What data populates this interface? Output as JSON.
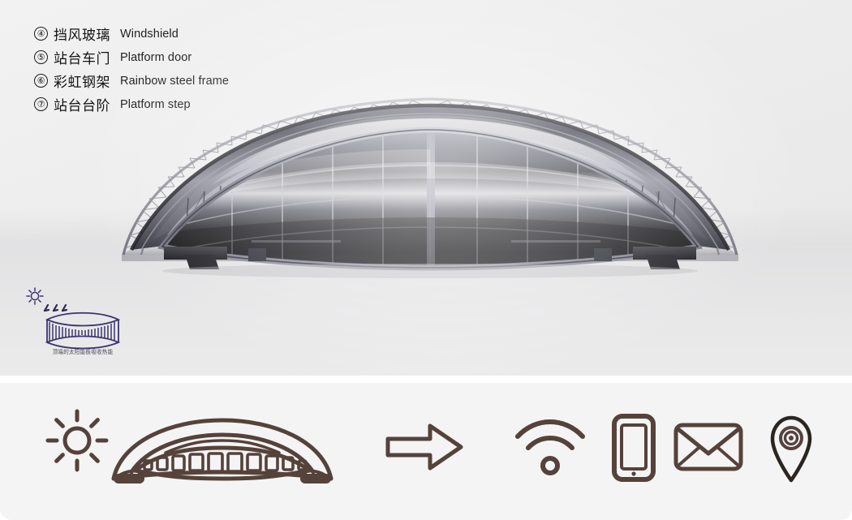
{
  "legend": {
    "items": [
      {
        "number": "④",
        "cn": "挡风玻璃",
        "en": "Windshield"
      },
      {
        "number": "⑤",
        "cn": "站台车门",
        "en": "Platform door"
      },
      {
        "number": "⑥",
        "cn": "彩虹钢架",
        "en": "Rainbow steel frame"
      },
      {
        "number": "⑦",
        "cn": "站台台阶",
        "en": "Platform step"
      }
    ]
  },
  "render": {
    "subject": "lens-shaped arched station building",
    "alt": "3D rendering of a rainbow steel frame transit station with curved glass facade"
  },
  "solar_diagram": {
    "caption": "顶端的太阳能板吸收热能",
    "sun_icon": "sun-icon",
    "heat_arrows": "heat-ray-arrows",
    "structure_icon": "lens-station-section",
    "color": "#3b3470"
  },
  "icon_bar": {
    "accent_color": "#55423a",
    "background": "#f4f4f4",
    "icons": [
      {
        "name": "sun-icon",
        "label": "Sun"
      },
      {
        "name": "arch-station-icon",
        "label": "Arch station"
      },
      {
        "name": "arrow-right-icon",
        "label": "Arrow right"
      },
      {
        "name": "wifi-icon",
        "label": "Wi-Fi"
      },
      {
        "name": "smartphone-icon",
        "label": "Smartphone"
      },
      {
        "name": "envelope-icon",
        "label": "Email"
      },
      {
        "name": "location-pin-icon",
        "label": "Location"
      }
    ]
  },
  "palette": {
    "render_bg": "#ededed",
    "icon_panel_bg": "#f4f4f4",
    "text_primary": "#141414",
    "solar_ink": "#3b3470",
    "icon_ink": "#55423a"
  }
}
